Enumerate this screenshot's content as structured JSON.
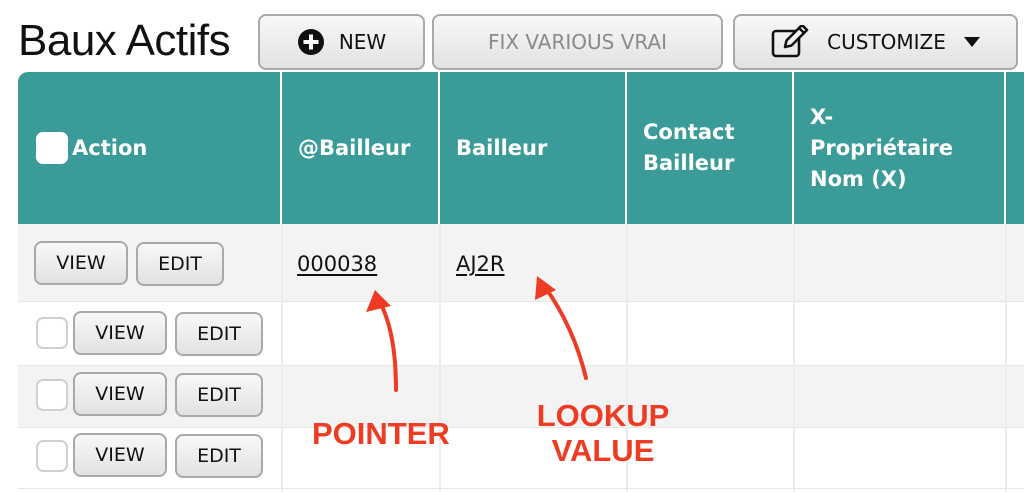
{
  "page": {
    "title": "Baux Actifs"
  },
  "toolbar": {
    "new_label": "NEW",
    "fix_label": "FIX VARIOUS VRAI",
    "customize_label": "CUSTOMIZE"
  },
  "table": {
    "headers": {
      "action": "Action",
      "bailleur_ptr": "@Bailleur",
      "bailleur": "Bailleur",
      "contact_1": "Contact",
      "contact_2": "Bailleur",
      "xprop_1": "X-",
      "xprop_2": "Propriétaire",
      "xprop_3": "Nom (X)"
    },
    "rows": [
      {
        "view_label": "VIEW",
        "edit_label": "EDIT",
        "bailleur_ptr": "000038",
        "bailleur": "AJ2R"
      },
      {
        "view_label": "VIEW",
        "edit_label": "EDIT",
        "bailleur_ptr": "",
        "bailleur": ""
      },
      {
        "view_label": "VIEW",
        "edit_label": "EDIT",
        "bailleur_ptr": "",
        "bailleur": ""
      },
      {
        "view_label": "VIEW",
        "edit_label": "EDIT",
        "bailleur_ptr": "",
        "bailleur": ""
      }
    ]
  },
  "annotations": {
    "pointer": "POINTER",
    "lookup_1": "LOOKUP",
    "lookup_2": "VALUE",
    "color": "#ee3b24"
  },
  "colors": {
    "header_bg": "#3b9b99",
    "row_alt_bg": "#f3f3f3"
  }
}
